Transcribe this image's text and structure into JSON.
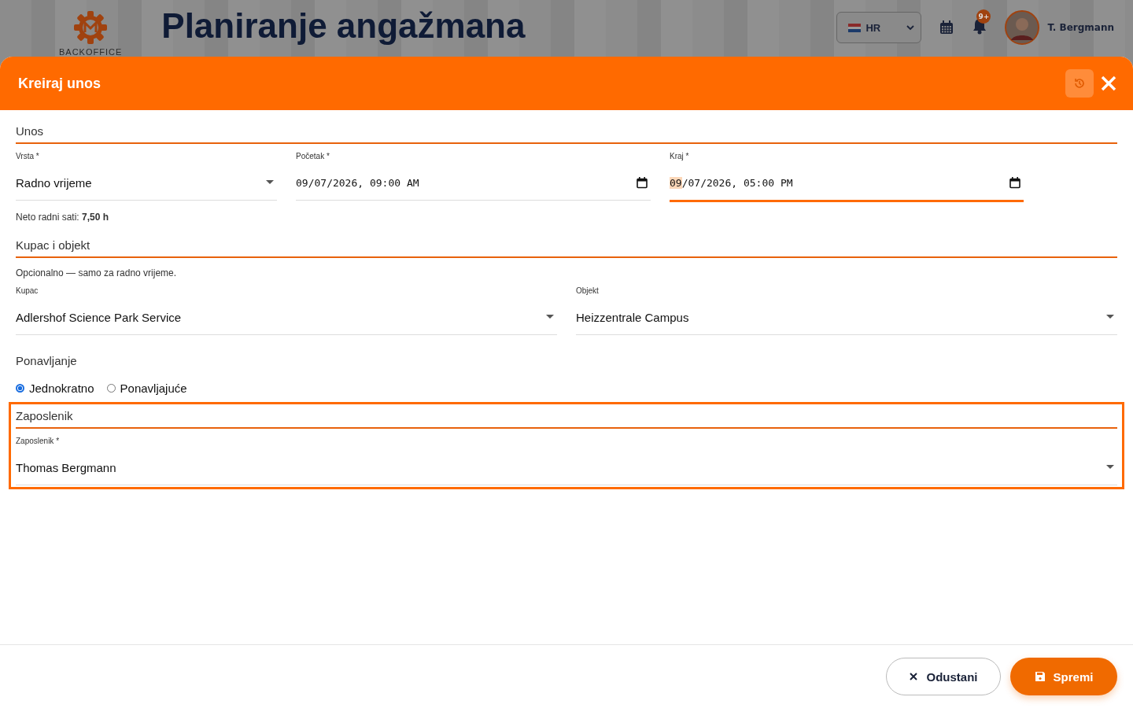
{
  "background": {
    "logo_text": "BACKOFFICE",
    "page_title": "Planiranje angažmana",
    "language": "HR",
    "notification_count": "9+",
    "user": "T. Bergmann"
  },
  "dialog": {
    "title": "Kreiraj unos",
    "history_disabled": true
  },
  "sections": [
    {
      "title": "Unos",
      "highlighted": false,
      "fields": [
        {
          "kind": "select",
          "label": "Vrsta *",
          "value": "Radno vrijeme",
          "focused": false
        },
        {
          "kind": "datetime",
          "label": "Početak *",
          "value": "09/07/2026, 09:00 AM",
          "focused": false
        },
        {
          "kind": "datetime",
          "label": "Kraj *",
          "value": "09/07/2026, 05:00 PM",
          "focused": true
        }
      ],
      "note": "Neto radni sati: **7,50 h**"
    },
    {
      "title": "Kupac i objekt",
      "highlighted": false,
      "intro": "Opcionalno — samo za radno vrijeme.",
      "fields": [
        {
          "kind": "select",
          "label": "Kupac",
          "value": "Adlershof Science Park Service",
          "focused": false
        },
        {
          "kind": "select",
          "label": "Objekt",
          "value": "Heizzentrale Campus",
          "focused": false
        }
      ]
    },
    {
      "title": "Ponavljanje",
      "kind": "radios",
      "highlighted": false,
      "options": [
        {
          "label": "Jednokratno",
          "selected": true
        },
        {
          "label": "Ponavljajuće",
          "selected": false
        }
      ]
    },
    {
      "title": "Zaposlenik",
      "highlighted": true,
      "fields": [
        {
          "kind": "select",
          "label": "Zaposlenik *",
          "value": "Thomas Bergmann",
          "focused": false
        }
      ]
    }
  ],
  "buttons": {
    "cancel": "Odustani",
    "save": "Spremi"
  }
}
